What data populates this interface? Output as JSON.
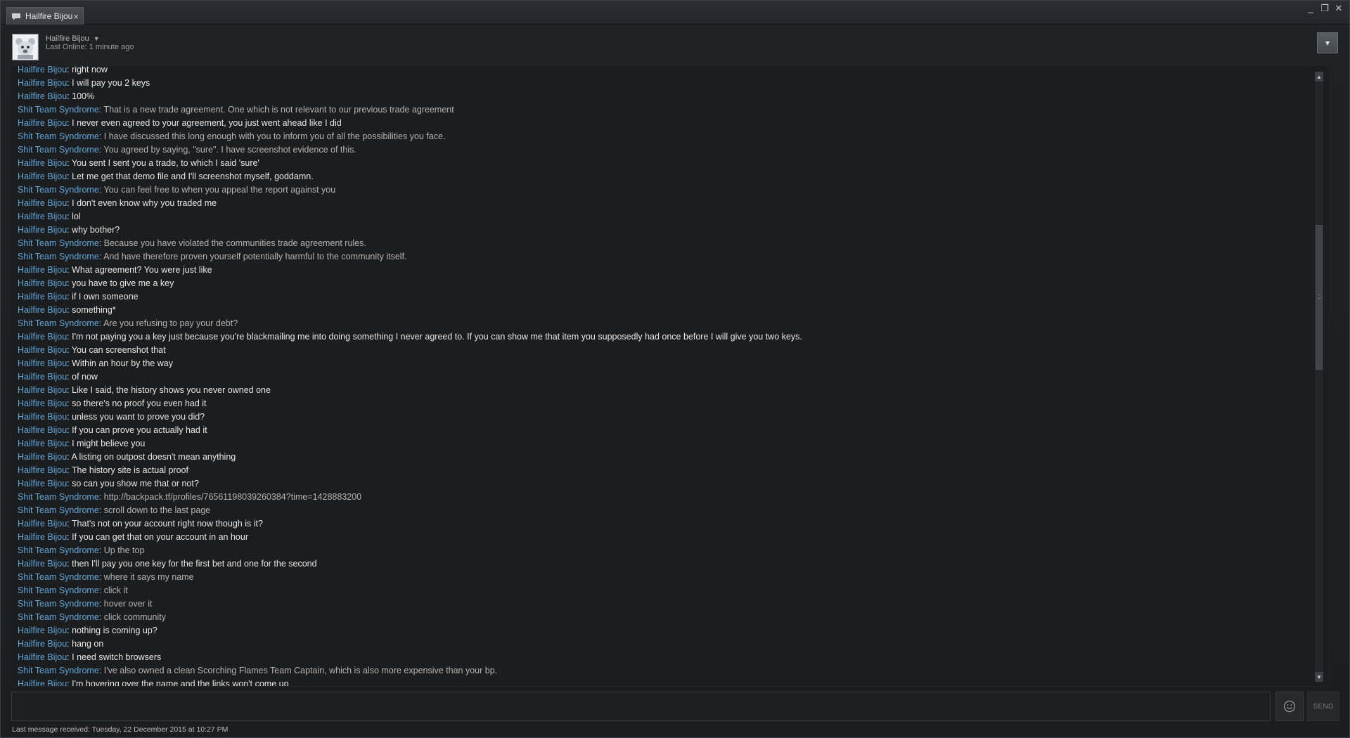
{
  "tab": {
    "title": "Hailfire Bijou",
    "close": "×",
    "icon": "chat-bubble-icon"
  },
  "window_controls": {
    "minimize": "_",
    "restore": "❐",
    "close": "✕"
  },
  "header": {
    "friend_name": "Hailfire Bijou",
    "last_online": "Last Online: 1 minute ago",
    "dropdown_icon": "▾"
  },
  "colors": {
    "speaker_name": "#62a6d8",
    "own_message": "#e7e7e7",
    "other_message": "#b4b4b4",
    "background": "#1c1d1f"
  },
  "messages": [
    {
      "who": "Hailfire Bijou",
      "text": "right now",
      "me": true
    },
    {
      "who": "Hailfire Bijou",
      "text": "I will pay you 2 keys",
      "me": true
    },
    {
      "who": "Hailfire Bijou",
      "text": "100%",
      "me": true
    },
    {
      "who": "Shit Team Syndrome",
      "text": "That is a new trade agreement. One which is not relevant to our previous trade agreement",
      "me": false
    },
    {
      "who": "Hailfire Bijou",
      "text": "I never even agreed to your agreement, you just went ahead like I did",
      "me": true
    },
    {
      "who": "Shit Team Syndrome",
      "text": "I have discussed this long enough with you to inform you of all the possibilities you face.",
      "me": false
    },
    {
      "who": "Shit Team Syndrome",
      "text": "You agreed by saying, \"sure\". I have screenshot evidence of this.",
      "me": false
    },
    {
      "who": "Hailfire Bijou",
      "text": "You sent I sent you a trade, to which I said 'sure'",
      "me": true
    },
    {
      "who": "Hailfire Bijou",
      "text": "Let me get that demo file and I'll screenshot myself, goddamn.",
      "me": true
    },
    {
      "who": "Shit Team Syndrome",
      "text": "You can feel free to when you appeal the report against you",
      "me": false
    },
    {
      "who": "Hailfire Bijou",
      "text": "I don't even know why you traded me",
      "me": true
    },
    {
      "who": "Hailfire Bijou",
      "text": "lol",
      "me": true
    },
    {
      "who": "Hailfire Bijou",
      "text": "why bother?",
      "me": true
    },
    {
      "who": "Shit Team Syndrome",
      "text": "Because you have violated the communities trade agreement rules.",
      "me": false
    },
    {
      "who": "Shit Team Syndrome",
      "text": "And have therefore proven yourself potentially harmful to the community itself.",
      "me": false
    },
    {
      "who": "Hailfire Bijou",
      "text": "What agreement? You were just like",
      "me": true
    },
    {
      "who": "Hailfire Bijou",
      "text": "you have to give me a key",
      "me": true
    },
    {
      "who": "Hailfire Bijou",
      "text": "if I own someone",
      "me": true
    },
    {
      "who": "Hailfire Bijou",
      "text": "something*",
      "me": true
    },
    {
      "who": "Shit Team Syndrome",
      "text": "Are you refusing to pay your debt?",
      "me": false
    },
    {
      "who": "Hailfire Bijou",
      "text": "I'm not paying you a key just because you're blackmailing me into doing something I never agreed to. If you can show me that item you supposedly had once before I will give you two keys.",
      "me": true
    },
    {
      "who": "Hailfire Bijou",
      "text": "You can screenshot that",
      "me": true
    },
    {
      "who": "Hailfire Bijou",
      "text": "Within an hour by the way",
      "me": true
    },
    {
      "who": "Hailfire Bijou",
      "text": "of now",
      "me": true
    },
    {
      "who": "Hailfire Bijou",
      "text": "Like I said, the history shows you never owned one",
      "me": true
    },
    {
      "who": "Hailfire Bijou",
      "text": "so there's no proof you even had it",
      "me": true
    },
    {
      "who": "Hailfire Bijou",
      "text": "unless you want to prove you did?",
      "me": true
    },
    {
      "who": "Hailfire Bijou",
      "text": "If you can prove you actually had it",
      "me": true
    },
    {
      "who": "Hailfire Bijou",
      "text": "I might believe you",
      "me": true
    },
    {
      "who": "Hailfire Bijou",
      "text": "A listing on outpost doesn't mean anything",
      "me": true
    },
    {
      "who": "Hailfire Bijou",
      "text": "The history site is actual proof",
      "me": true
    },
    {
      "who": "Hailfire Bijou",
      "text": "so can you show me that or not?",
      "me": true
    },
    {
      "who": "Shit Team Syndrome",
      "text": "http://backpack.tf/profiles/76561198039260384?time=1428883200",
      "me": false,
      "link": true
    },
    {
      "who": "Shit Team Syndrome",
      "text": "scroll down to the last page",
      "me": false
    },
    {
      "who": "Hailfire Bijou",
      "text": "That's not on your account right now though is it?",
      "me": true
    },
    {
      "who": "Hailfire Bijou",
      "text": "If you can get that on your account in an hour",
      "me": true
    },
    {
      "who": "Shit Team Syndrome",
      "text": "Up the top",
      "me": false
    },
    {
      "who": "Hailfire Bijou",
      "text": "then I'll pay you one key for the first bet and one for the second",
      "me": true
    },
    {
      "who": "Shit Team Syndrome",
      "text": "where it says my name",
      "me": false
    },
    {
      "who": "Shit Team Syndrome",
      "text": "click it",
      "me": false
    },
    {
      "who": "Shit Team Syndrome",
      "text": "hover over it",
      "me": false
    },
    {
      "who": "Shit Team Syndrome",
      "text": "click community",
      "me": false
    },
    {
      "who": "Hailfire Bijou",
      "text": "nothing is coming up?",
      "me": true
    },
    {
      "who": "Hailfire Bijou",
      "text": "hang on",
      "me": true
    },
    {
      "who": "Hailfire Bijou",
      "text": "I need switch browsers",
      "me": true
    },
    {
      "who": "Shit Team Syndrome",
      "text": "I've also owned a clean Scorching Flames Team Captain, which is also more expensive than your bp.",
      "me": false
    },
    {
      "who": "Hailfire Bijou",
      "text": "I'm hovering over the name and the links won't come up",
      "me": true
    }
  ],
  "scrollbar": {
    "up": "▲",
    "down": "▼",
    "position": 0.28
  },
  "input": {
    "value": "",
    "placeholder": ""
  },
  "emoticon_icon": "smiley-icon",
  "send_label": "SEND",
  "status": "Last message received: Tuesday, 22 December 2015 at 10:27 PM"
}
